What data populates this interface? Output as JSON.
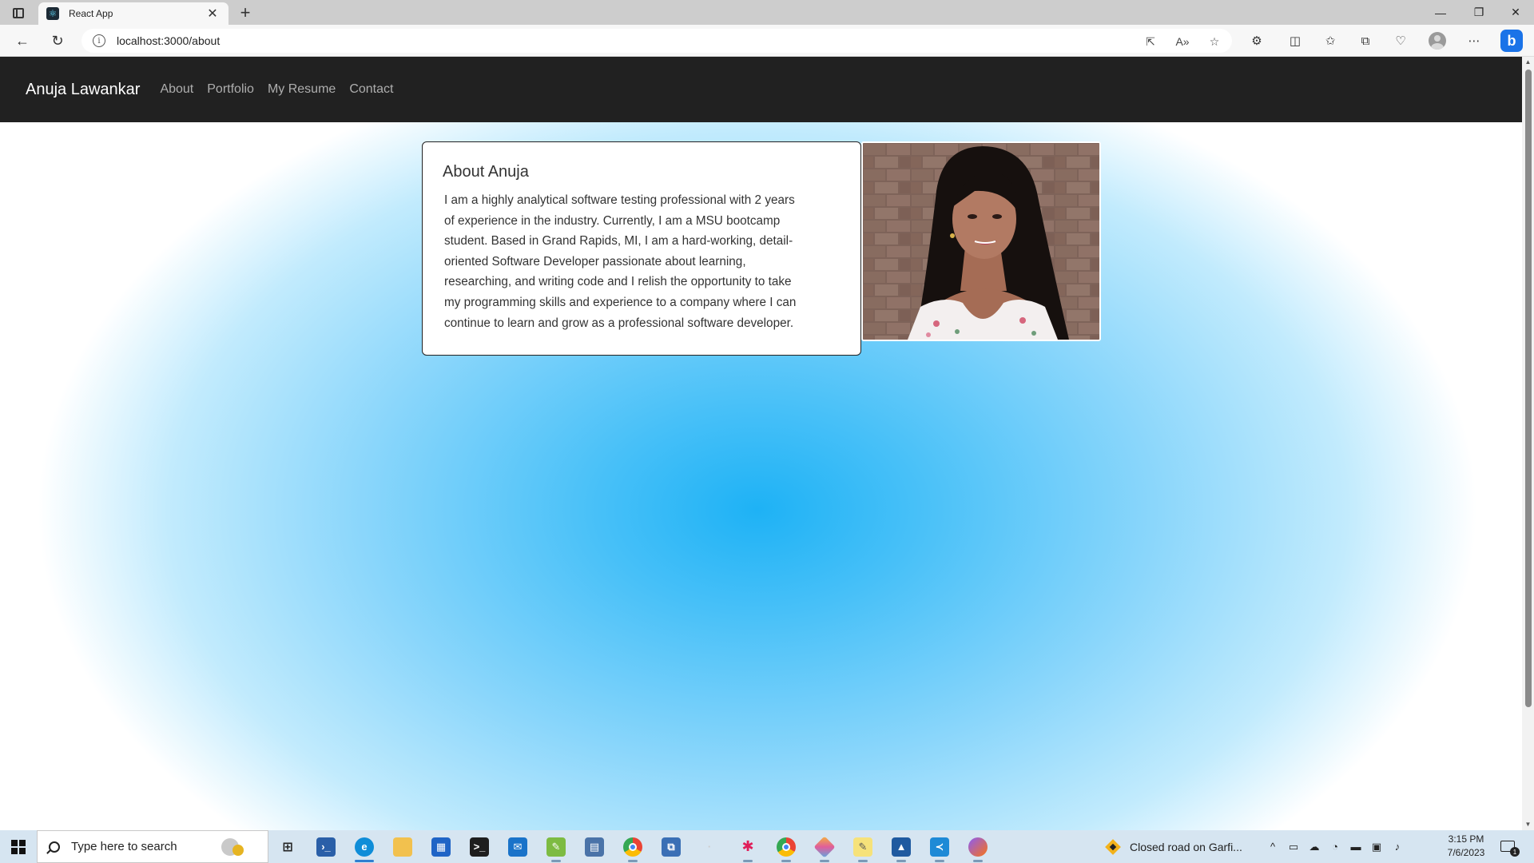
{
  "browser": {
    "tab_title": "React App",
    "tab_close": "✕",
    "new_tab": "+",
    "url": "localhost:3000/about",
    "window_minimize": "—",
    "window_restore": "❐",
    "window_close": "✕"
  },
  "navbar": {
    "brand": "Anuja Lawankar",
    "links": [
      "About",
      "Portfolio",
      "My Resume",
      "Contact"
    ]
  },
  "about": {
    "title": "About Anuja",
    "lines": [
      "I am a highly analytical software testing professional with 2 years",
      "of experience in the industry. Currently, I am a MSU bootcamp",
      "student. Based in Grand Rapids, MI, I am a hard-working, detail-",
      "oriented Software Developer passionate about learning,",
      "researching, and writing code and I relish the opportunity to take",
      "my programming skills and experience to a company where I can",
      "continue to learn and grow as a professional software developer."
    ]
  },
  "colors": {
    "navbar_bg": "#212121",
    "nav_link": "#aeaeae",
    "background_center": "#1eb2f5",
    "background_edge": "#ffffff"
  },
  "taskbar": {
    "search_placeholder": "Type here to search",
    "notification_text": "Closed road on Garfi...",
    "time": "3:15 PM",
    "date": "7/6/2023",
    "notification_badge": "1",
    "pinned_icons": [
      "task-view-icon",
      "powershell-icon",
      "edge-icon",
      "file-explorer-icon",
      "microsoft-store-icon",
      "terminal-icon",
      "mail-icon",
      "notepad-plus-icon",
      "calculator-icon",
      "chrome-icon",
      "remote-desktop-icon",
      "blank-app-icon",
      "slack-icon",
      "chrome-profile-icon",
      "git-icon",
      "sticky-notes-icon",
      "photos-icon",
      "vscode-icon",
      "fox-app-icon"
    ]
  }
}
